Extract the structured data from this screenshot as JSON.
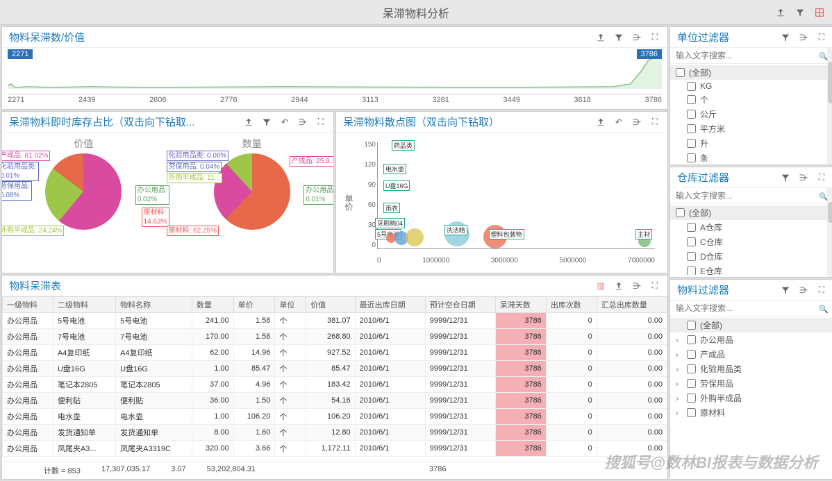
{
  "app_title": "呆滞物料分析",
  "panels": {
    "topline": {
      "title": "物料呆滞数/价值",
      "start_tag": "2271",
      "end_tag": "3786",
      "xticks": [
        "2271",
        "2439",
        "2608",
        "2776",
        "2944",
        "3113",
        "3281",
        "3449",
        "3618",
        "3786"
      ]
    },
    "pie": {
      "title": "呆滞物料即时库存占比（双击向下钻取...",
      "sub1": "价值",
      "sub2": "数量",
      "labels1": [
        {
          "text": "产成品: 61.02%",
          "color": "#d94b9e"
        },
        {
          "text": "化验用品类:\n0.01%",
          "color": "#66c"
        },
        {
          "text": "劳保用品:\n0.08%",
          "color": "#5b6fb5"
        },
        {
          "text": "外购半成品: 24.24%",
          "color": "#9ec648"
        },
        {
          "text": "办公用品:\n0.02%",
          "color": "#5aa35a"
        },
        {
          "text": "原材料:\n14.63%",
          "color": "#e55"
        }
      ],
      "labels2": [
        {
          "text": "化验用品类: 0.00%",
          "color": "#66c"
        },
        {
          "text": "劳保用品: 0.04%",
          "color": "#5b6fb5"
        },
        {
          "text": "外购半成品: 11...",
          "color": "#9ec648"
        },
        {
          "text": "原材料: 62.25%",
          "color": "#e55"
        },
        {
          "text": "产成品: 25.9...",
          "color": "#d94b9e"
        },
        {
          "text": "办公用品:\n0.01%",
          "color": "#5aa35a"
        }
      ]
    },
    "scatter": {
      "title": "呆滞物料散点图（双击向下钻取）",
      "ylabel": "单价",
      "xticks": [
        "0",
        "1000000",
        "3000000",
        "5000000",
        "7000000"
      ],
      "yticks": [
        "0",
        "30",
        "60",
        "90",
        "120",
        "150"
      ],
      "bubbles": [
        {
          "label": "药品类"
        },
        {
          "label": "电水壶"
        },
        {
          "label": "U盘16G"
        },
        {
          "label": "雨衣"
        },
        {
          "label": "牙刷柄04"
        },
        {
          "label": "5号电池"
        },
        {
          "label": "洗洁精"
        },
        {
          "label": "塑料包装物"
        },
        {
          "label": "主材"
        }
      ]
    },
    "table": {
      "title": "物料呆滞表",
      "headers": [
        "一级物料",
        "二级物料",
        "物料名称",
        "数量",
        "单价",
        "单位",
        "价值",
        "最近出库日期",
        "预计空仓日期",
        "呆滞天数",
        "出库次数",
        "汇总出库数量"
      ],
      "rows": [
        [
          "办公用品",
          "5号电池",
          "5号电池",
          "241.00",
          "1.58",
          "个",
          "381.07",
          "2010/6/1",
          "9999/12/31",
          "3786",
          "0",
          "0.00"
        ],
        [
          "办公用品",
          "7号电池",
          "7号电池",
          "170.00",
          "1.58",
          "个",
          "268.80",
          "2010/6/1",
          "9999/12/31",
          "3786",
          "0",
          "0.00"
        ],
        [
          "办公用品",
          "A4复印纸",
          "A4复印纸",
          "62.00",
          "14.96",
          "个",
          "927.52",
          "2010/6/1",
          "9999/12/31",
          "3786",
          "0",
          "0.00"
        ],
        [
          "办公用品",
          "U盘16G",
          "U盘16G",
          "1.00",
          "85.47",
          "个",
          "85.47",
          "2010/6/1",
          "9999/12/31",
          "3786",
          "0",
          "0.00"
        ],
        [
          "办公用品",
          "笔记本2805",
          "笔记本2805",
          "37.00",
          "4.96",
          "个",
          "183.42",
          "2010/6/1",
          "9999/12/31",
          "3786",
          "0",
          "0.00"
        ],
        [
          "办公用品",
          "便利贴",
          "便利贴",
          "36.00",
          "1.50",
          "个",
          "54.16",
          "2010/6/1",
          "9999/12/31",
          "3786",
          "0",
          "0.00"
        ],
        [
          "办公用品",
          "电水壶",
          "电水壶",
          "1.00",
          "106.20",
          "个",
          "106.20",
          "2010/6/1",
          "9999/12/31",
          "3786",
          "0",
          "0.00"
        ],
        [
          "办公用品",
          "发货通知单",
          "发货通知单",
          "8.00",
          "1.60",
          "个",
          "12.80",
          "2010/6/1",
          "9999/12/31",
          "3786",
          "0",
          "0.00"
        ],
        [
          "办公用品",
          "凤尾夹A3...",
          "凤尾夹A3319C",
          "320.00",
          "3.66",
          "个",
          "1,172.11",
          "2010/6/1",
          "9999/12/31",
          "3786",
          "0",
          "0.00"
        ]
      ],
      "footer": {
        "count": "计数 = 853",
        "sum_qty": "17,307,035.17",
        "avg_price": "3.07",
        "sum_value": "53,202,804.31",
        "days": "3786"
      }
    },
    "filter_unit": {
      "title": "单位过滤器",
      "placeholder": "输入文字搜索...",
      "all": "(全部)",
      "items": [
        "KG",
        "个",
        "公斤",
        "平方米",
        "升",
        "条"
      ]
    },
    "filter_wh": {
      "title": "仓库过滤器",
      "placeholder": "输入文字搜索...",
      "all": "(全部)",
      "items": [
        "A仓库",
        "C仓库",
        "D仓库",
        "E仓库"
      ]
    },
    "filter_mat": {
      "title": "物料过滤器",
      "placeholder": "输入文字搜索...",
      "all": "(全部)",
      "items": [
        "办公用品",
        "产成品",
        "化验用品类",
        "劳保用品",
        "外购半成品",
        "原材料"
      ]
    }
  },
  "watermark": "搜狐号@数林BI报表与数据分析",
  "chart_data": [
    {
      "type": "line",
      "title": "物料呆滞数/价值",
      "xlim": [
        2271,
        3786
      ],
      "series": [
        {
          "name": "value",
          "values_note": "flat near 0 then sharp rise at ~3750"
        }
      ]
    },
    {
      "type": "pie",
      "title": "价值",
      "series": [
        {
          "name": "产成品",
          "value": 61.02
        },
        {
          "name": "外购半成品",
          "value": 24.24
        },
        {
          "name": "原材料",
          "value": 14.63
        },
        {
          "name": "劳保用品",
          "value": 0.08
        },
        {
          "name": "办公用品",
          "value": 0.02
        },
        {
          "name": "化验用品类",
          "value": 0.01
        }
      ]
    },
    {
      "type": "pie",
      "title": "数量",
      "series": [
        {
          "name": "原材料",
          "value": 62.25
        },
        {
          "name": "产成品",
          "value": 25.9
        },
        {
          "name": "外购半成品",
          "value": 11
        },
        {
          "name": "劳保用品",
          "value": 0.04
        },
        {
          "name": "办公用品",
          "value": 0.01
        },
        {
          "name": "化验用品类",
          "value": 0.0
        }
      ]
    },
    {
      "type": "scatter",
      "title": "呆滞物料散点图",
      "xlabel": "",
      "ylabel": "单价",
      "xlim": [
        0,
        7000000
      ],
      "ylim": [
        0,
        150
      ],
      "points": [
        {
          "label": "药品类",
          "x": 150000,
          "y": 150
        },
        {
          "label": "电水壶",
          "x": 150000,
          "y": 115
        },
        {
          "label": "U盘16G",
          "x": 150000,
          "y": 85
        },
        {
          "label": "雨衣",
          "x": 150000,
          "y": 55
        },
        {
          "label": "牙刷柄04",
          "x": 100000,
          "y": 35
        },
        {
          "label": "5号电池",
          "x": 200000,
          "y": 5
        },
        {
          "label": "洗洁精",
          "x": 1800000,
          "y": 10
        },
        {
          "label": "塑料包装物",
          "x": 3000000,
          "y": 5
        },
        {
          "label": "主材",
          "x": 6900000,
          "y": 8
        }
      ]
    }
  ]
}
